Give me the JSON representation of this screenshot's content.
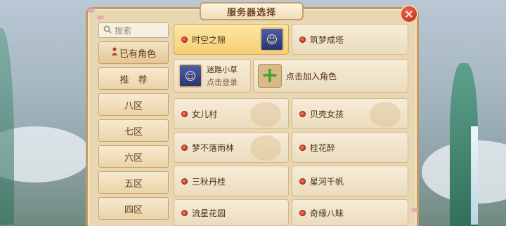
{
  "window": {
    "title": "服务器选择",
    "close": "✕"
  },
  "sidebar": {
    "search_placeholder": "搜索",
    "items": [
      "已有角色",
      "推　荐",
      "八区",
      "七区",
      "六区",
      "五区",
      "四区"
    ]
  },
  "servers": {
    "top": [
      {
        "name": "时空之隙",
        "selected": true
      },
      {
        "name": "筑梦成塔",
        "selected": false
      }
    ],
    "character": {
      "name": "迷路小草",
      "action": "点击登录"
    },
    "add_role": "点击加入角色",
    "list": [
      "女儿村",
      "贝壳女孩",
      "梦不落雨林",
      "桂花醉",
      "三秋丹桂",
      "星河千帆",
      "流星花园",
      "奇缘八昧"
    ]
  },
  "colors": {
    "accent": "#c0261b",
    "panel": "#e9d7b3",
    "selected": "#f4cf74"
  }
}
